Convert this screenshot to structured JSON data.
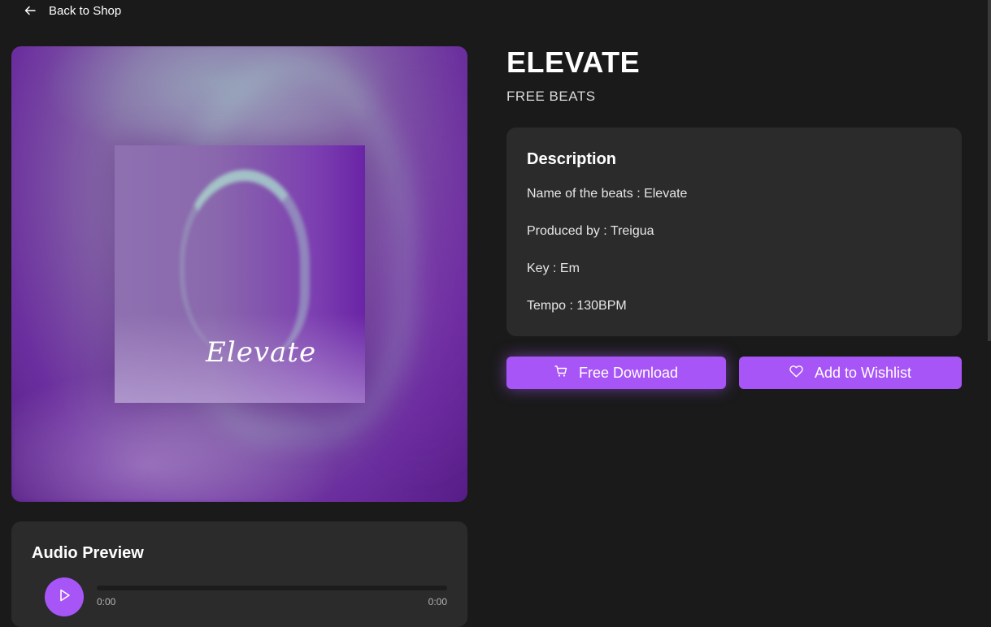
{
  "nav": {
    "back_label": "Back to Shop"
  },
  "product": {
    "title": "ELEVATE",
    "subtitle": "FREE BEATS",
    "cover_text": "Elevate"
  },
  "description": {
    "heading": "Description",
    "lines": [
      "Name of the beats : Elevate",
      "Produced by : Treigua",
      "Key : Em",
      "Tempo : 130BPM"
    ]
  },
  "actions": {
    "download_label": "Free Download",
    "wishlist_label": "Add to Wishlist"
  },
  "audio": {
    "heading": "Audio Preview",
    "current_time": "0:00",
    "duration": "0:00",
    "progress": 0
  },
  "colors": {
    "accent": "#a855f7",
    "background": "#1a1a1a",
    "card": "#2b2b2b"
  },
  "icons": {
    "back": "arrow-left-icon",
    "download": "cart-icon",
    "wishlist": "heart-icon",
    "play": "play-icon"
  }
}
